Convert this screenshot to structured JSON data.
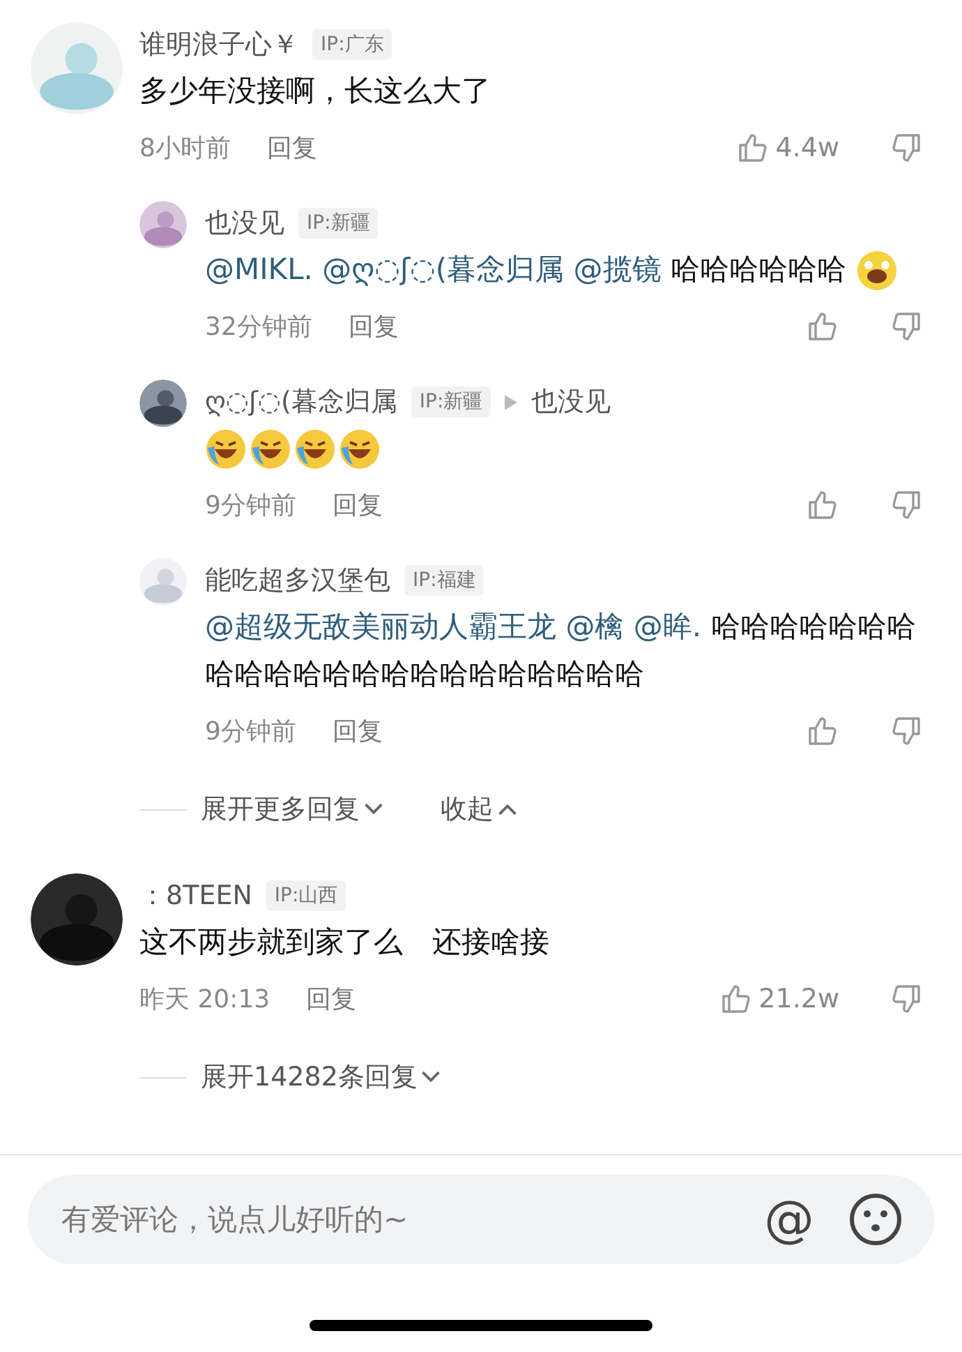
{
  "comments": [
    {
      "user": "谁明浪子心￥",
      "ip": "IP:广东",
      "body": [
        {
          "kind": "text",
          "text": "多少年没接啊，长这么大了"
        }
      ],
      "time": "8小时前",
      "reply": "回复",
      "likes": "4.4w",
      "replies": [
        {
          "user": "也没见",
          "ip": "IP:新疆",
          "body": [
            {
              "kind": "mention",
              "text": "@MIKL."
            },
            {
              "kind": "mention",
              "text": "@ღ◌ʃ◌(暮念归属"
            },
            {
              "kind": "mention",
              "text": "@揽镜"
            },
            {
              "kind": "text",
              "text": "哈哈哈哈哈哈"
            },
            {
              "kind": "grin_emoji"
            }
          ],
          "time": "32分钟前",
          "reply": "回复"
        },
        {
          "user": "ღ◌ʃ◌(暮念归属",
          "ip": "IP:新疆",
          "reply_to": "也没见",
          "body": [
            {
              "kind": "tears_emoji"
            },
            {
              "kind": "tears_emoji"
            },
            {
              "kind": "tears_emoji"
            },
            {
              "kind": "tears_emoji"
            }
          ],
          "time": "9分钟前",
          "reply": "回复"
        },
        {
          "user": "能吃超多汉堡包",
          "ip": "IP:福建",
          "body": [
            {
              "kind": "mention",
              "text": "@超级无敌美丽动人霸王龙"
            },
            {
              "kind": "mention",
              "text": "@檎"
            },
            {
              "kind": "mention",
              "text": "@眸."
            },
            {
              "kind": "text",
              "text": "哈哈哈哈哈哈哈哈哈哈哈哈哈哈哈哈哈哈哈哈哈哈"
            }
          ],
          "time": "9分钟前",
          "reply": "回复"
        }
      ],
      "more": [
        {
          "kind": "expand",
          "label": "展开更多回复"
        },
        {
          "kind": "collapse",
          "label": "收起"
        }
      ]
    },
    {
      "user": "：8TEEN",
      "ip": "IP:山西",
      "body": [
        {
          "kind": "text",
          "text": "这不两步就到家了么　还接啥接"
        }
      ],
      "time": "昨天 20:13",
      "reply": "回复",
      "likes": "21.2w",
      "more": [
        {
          "kind": "expand",
          "label": "展开14282条回复"
        }
      ]
    }
  ],
  "composer": {
    "placeholder": "有爱评论，说点儿好听的~",
    "at": "@"
  }
}
